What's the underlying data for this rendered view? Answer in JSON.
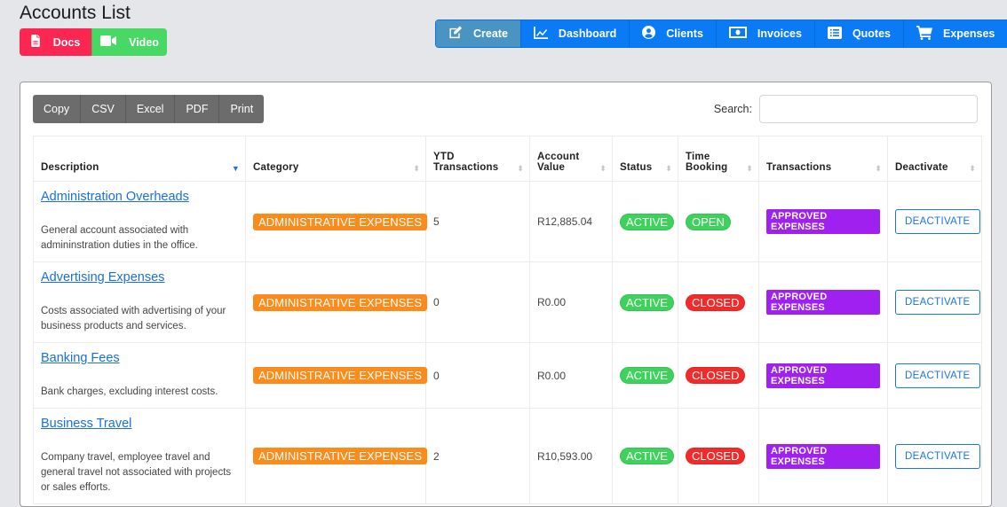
{
  "header": {
    "title": "Accounts List",
    "help_buttons": [
      {
        "label": "Docs",
        "icon": "file-icon",
        "color": "#fb2651"
      },
      {
        "label": "Video",
        "icon": "video-icon",
        "color": "#48d864"
      }
    ]
  },
  "nav": {
    "items": [
      {
        "label": "Create",
        "icon": "edit-icon",
        "active": true
      },
      {
        "label": "Dashboard",
        "icon": "chart-line-icon"
      },
      {
        "label": "Clients",
        "icon": "user-circle-icon"
      },
      {
        "label": "Invoices",
        "icon": "money-bill-icon"
      },
      {
        "label": "Quotes",
        "icon": "list-alt-icon"
      },
      {
        "label": "Expenses",
        "icon": "shopping-cart-icon"
      }
    ],
    "accent_color": "#0b7bf5"
  },
  "toolbar": {
    "export_buttons": [
      "Copy",
      "CSV",
      "Excel",
      "PDF",
      "Print"
    ],
    "search_label": "Search:",
    "search_value": "",
    "search_placeholder": ""
  },
  "table": {
    "columns": [
      {
        "label": "Description",
        "sort": "desc"
      },
      {
        "label": "Category",
        "sort": "none"
      },
      {
        "label": "YTD Transactions",
        "sort": "none"
      },
      {
        "label": "Account Value",
        "sort": "none"
      },
      {
        "label": "Status",
        "sort": "none"
      },
      {
        "label": "Time Booking",
        "sort": "none"
      },
      {
        "label": "Transactions",
        "sort": "none"
      },
      {
        "label": "Deactivate",
        "sort": "none"
      }
    ],
    "rows": [
      {
        "name": "Administration Overheads",
        "description": "General account associated with admininstration duties in the office.",
        "category": "ADMINISTRATIVE EXPENSES",
        "ytd_transactions": "5",
        "account_value": "R12,885.04",
        "status": "ACTIVE",
        "time_booking": "OPEN",
        "transactions": "APPROVED EXPENSES",
        "action": "DEACTIVATE"
      },
      {
        "name": "Advertising Expenses",
        "description": "Costs associated with advertising of your business products and services.",
        "category": "ADMINISTRATIVE EXPENSES",
        "ytd_transactions": "0",
        "account_value": "R0.00",
        "status": "ACTIVE",
        "time_booking": "CLOSED",
        "transactions": "APPROVED EXPENSES",
        "action": "DEACTIVATE"
      },
      {
        "name": "Banking Fees",
        "description": "Bank charges, excluding interest costs.",
        "category": "ADMINISTRATIVE EXPENSES",
        "ytd_transactions": "0",
        "account_value": "R0.00",
        "status": "ACTIVE",
        "time_booking": "CLOSED",
        "transactions": "APPROVED EXPENSES",
        "action": "DEACTIVATE"
      },
      {
        "name": "Business Travel",
        "description": "Company travel, employee travel and general travel not associated with projects or sales efforts.",
        "category": "ADMINISTRATIVE EXPENSES",
        "ytd_transactions": "2",
        "account_value": "R10,593.00",
        "status": "ACTIVE",
        "time_booking": "CLOSED",
        "transactions": "APPROVED EXPENSES",
        "action": "DEACTIVATE"
      }
    ]
  },
  "colors": {
    "category_badge": "#fb8c1b",
    "active_green": "#3ed25c",
    "closed_red": "#f32a2a",
    "approved_purple": "#a020f0",
    "link_blue": "#1a6fe0"
  }
}
